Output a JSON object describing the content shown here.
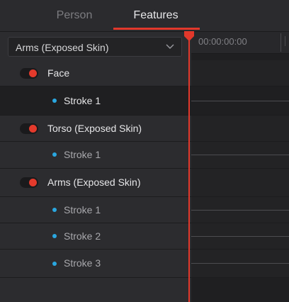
{
  "tabs": [
    {
      "label": "Person"
    },
    {
      "label": "Features"
    }
  ],
  "dropdown": {
    "value": "Arms (Exposed Skin)"
  },
  "timeline": {
    "timecode": "00:00:00:00"
  },
  "rows": [
    {
      "type": "feature",
      "label": "Face"
    },
    {
      "type": "stroke",
      "label": "Stroke 1"
    },
    {
      "type": "feature",
      "label": "Torso (Exposed Skin)"
    },
    {
      "type": "stroke",
      "label": "Stroke 1"
    },
    {
      "type": "feature",
      "label": "Arms (Exposed Skin)"
    },
    {
      "type": "stroke",
      "label": "Stroke 1"
    },
    {
      "type": "stroke",
      "label": "Stroke 2"
    },
    {
      "type": "stroke",
      "label": "Stroke 3"
    }
  ],
  "colors": {
    "accent": "#e2382b",
    "stroke_dot": "#2aa7e0"
  },
  "icons": {
    "dropdown": "chevron-down-icon",
    "playhead": "playhead-marker-icon"
  }
}
